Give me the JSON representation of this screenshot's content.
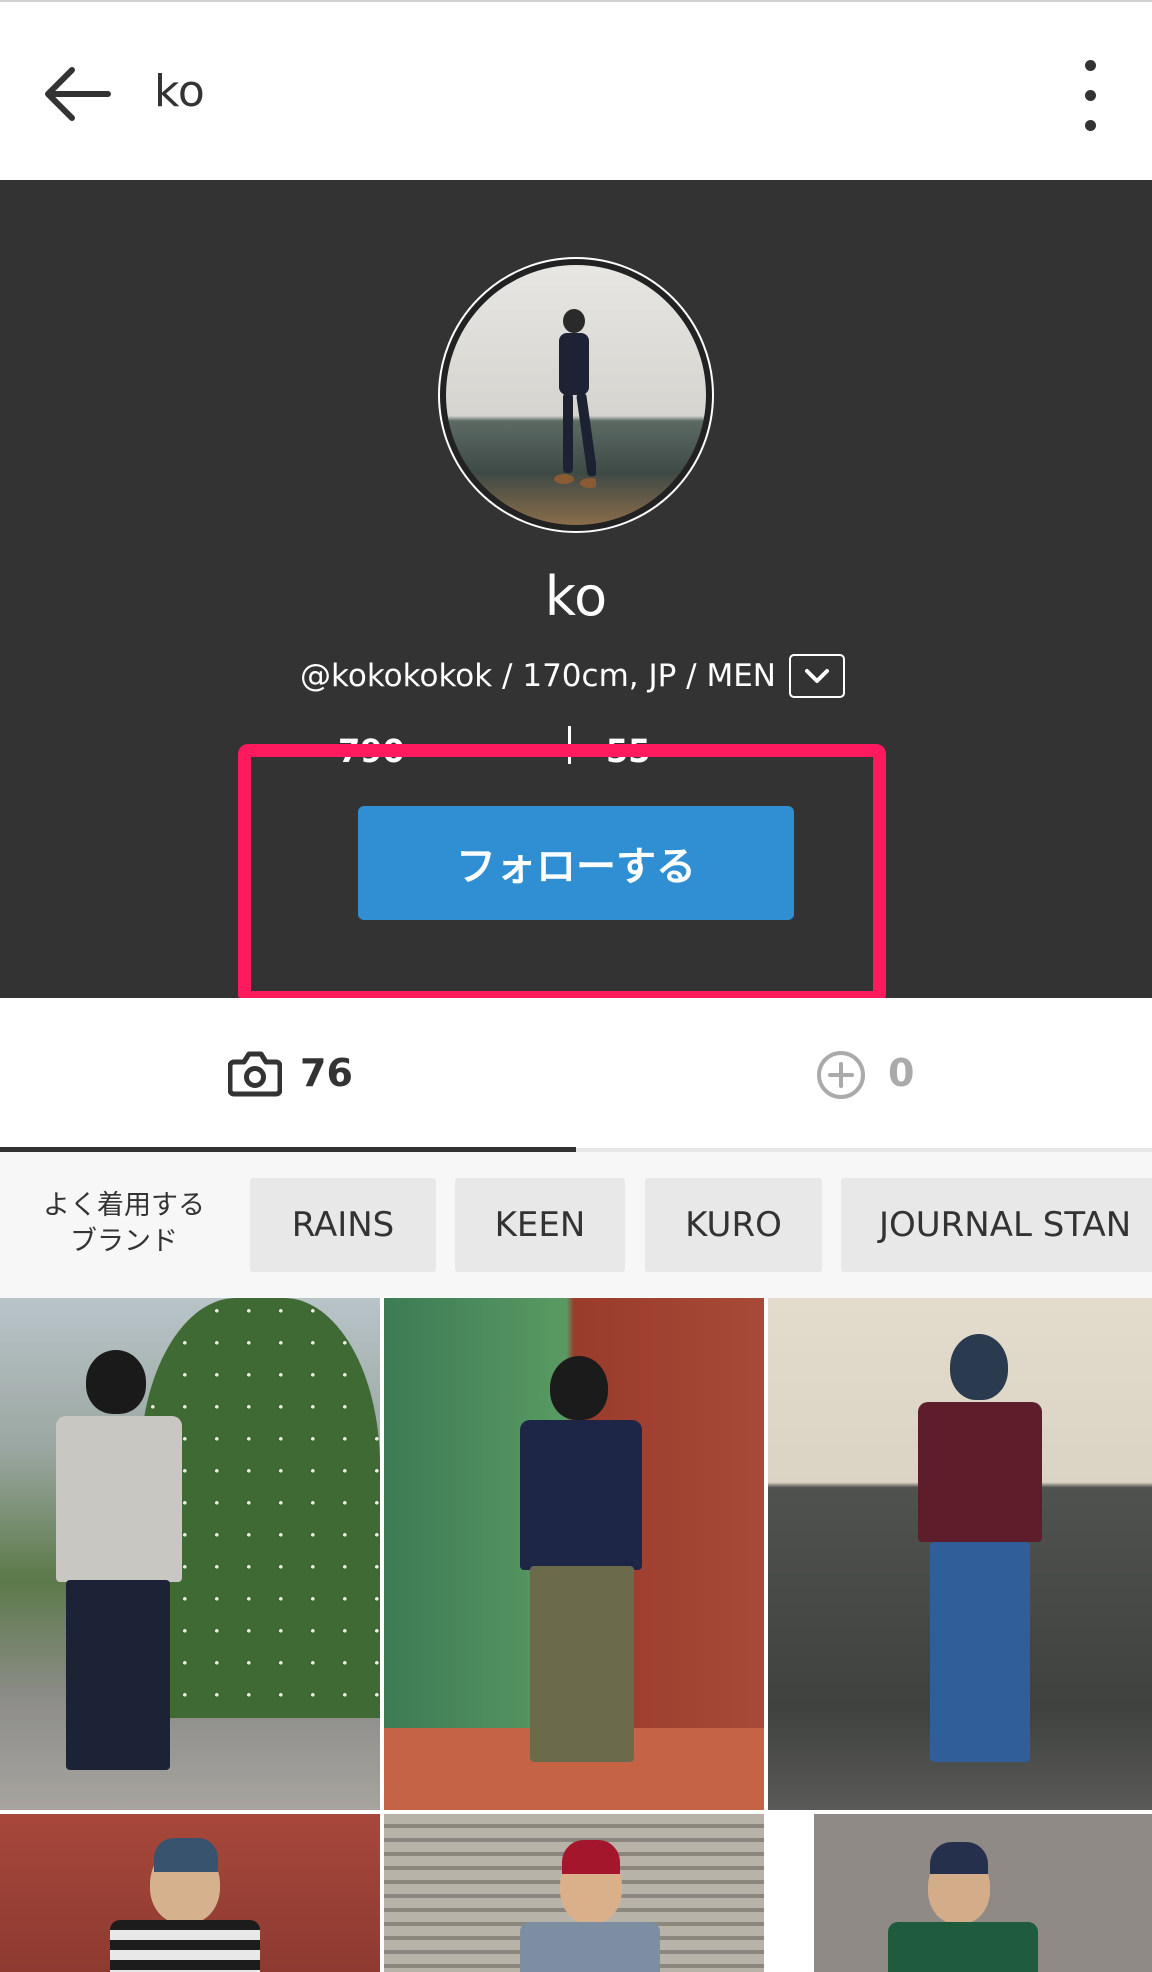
{
  "toolbar": {
    "title": "ko"
  },
  "profile": {
    "name": "ko",
    "meta": "@kokokokok / 170cm, JP / MEN",
    "stats_partial_left": "790",
    "stats_partial_right": "55",
    "follow_label": "フォローする"
  },
  "tabs": [
    {
      "icon": "camera-icon",
      "count": "76"
    },
    {
      "icon": "plus-circle-icon",
      "count": "0"
    }
  ],
  "brands": {
    "label": "よく着用する\nブランド",
    "items": [
      "RAINS",
      "KEEN",
      "KURO",
      "JOURNAL STAN"
    ]
  },
  "colors": {
    "accent": "#2f8fd2",
    "highlight": "#ff1a5e",
    "hero_bg": "#333333"
  }
}
